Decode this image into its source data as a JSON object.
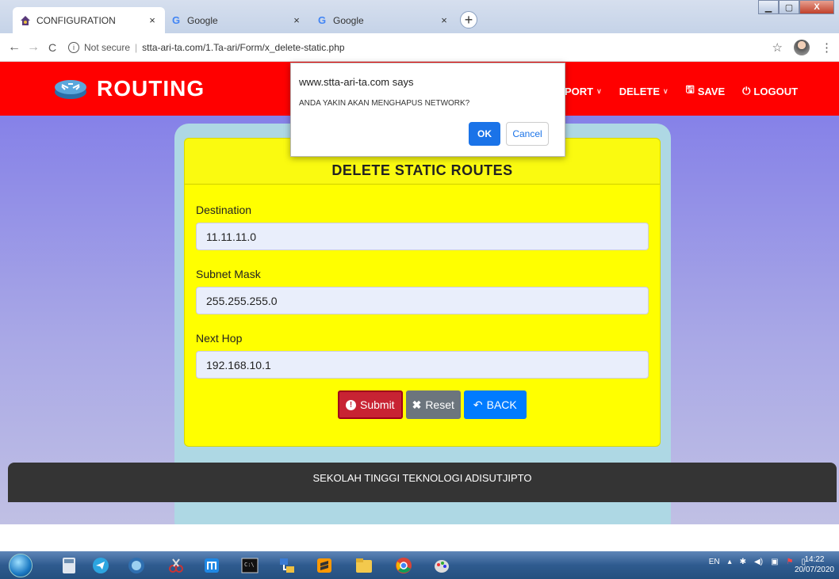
{
  "browser": {
    "tabs": [
      {
        "title": "CONFIGURATION",
        "favicon": "house-icon",
        "active": true
      },
      {
        "title": "Google",
        "favicon": "google-g-icon",
        "active": false
      },
      {
        "title": "Google",
        "favicon": "google-g-icon",
        "active": false
      }
    ],
    "close_glyph": "×",
    "new_tab_glyph": "+",
    "security_label": "Not secure",
    "url": "stta-ari-ta.com/1.Ta-ari/Form/x_delete-static.php"
  },
  "navbar": {
    "brand": "ROUTING",
    "menu": [
      {
        "label": "PORT",
        "has_dropdown": true
      },
      {
        "label": "DELETE",
        "has_dropdown": true
      },
      {
        "label": "SAVE",
        "icon": "floppy-icon",
        "has_dropdown": false
      },
      {
        "label": "LOGOUT",
        "icon": "power-icon",
        "has_dropdown": false
      }
    ]
  },
  "form": {
    "title": "DELETE STATIC ROUTES",
    "fields": [
      {
        "label": "Destination",
        "value": "11.11.11.0"
      },
      {
        "label": "Subnet Mask",
        "value": "255.255.255.0"
      },
      {
        "label": "Next Hop",
        "value": "192.168.10.1"
      }
    ],
    "buttons": {
      "submit": "Submit",
      "reset": "Reset",
      "back": "BACK"
    }
  },
  "dialog": {
    "origin": "www.stta-ari-ta.com says",
    "message": "ANDA YAKIN AKAN MENGHAPUS NETWORK?",
    "ok": "OK",
    "cancel": "Cancel"
  },
  "footer": {
    "text": "SEKOLAH TINGGI TEKNOLOGI ADISUTJIPTO"
  },
  "taskbar": {
    "language": "EN",
    "time": "14:22",
    "date": "20/07/2020"
  },
  "colors": {
    "navbar": "#ff0000",
    "card": "#ffff00",
    "outer_panel": "#aed8e4",
    "submit": "#c82333",
    "reset": "#6c757d",
    "back": "#007bff"
  }
}
